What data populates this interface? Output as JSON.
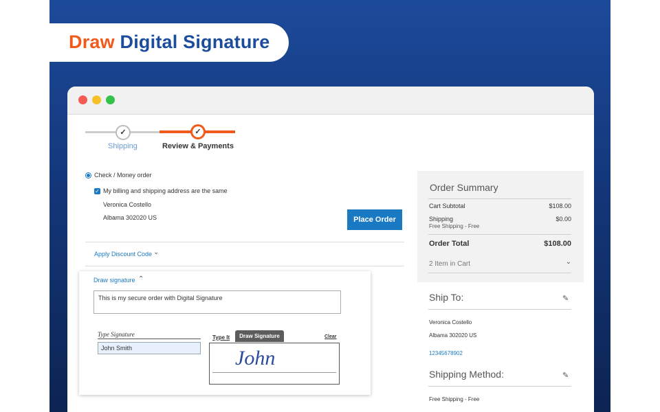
{
  "banner": {
    "title_accent": "Draw",
    "title_main": "Digital Signature"
  },
  "colors": {
    "accent_orange": "#f05a1a",
    "brand_blue": "#1979c3",
    "background_blue": "#1c4a9a"
  },
  "browser": {
    "window_controls": [
      "close",
      "minimize",
      "maximize"
    ]
  },
  "progress": {
    "steps": [
      {
        "label": "Shipping",
        "state": "complete"
      },
      {
        "label": "Review & Payments",
        "state": "active"
      }
    ]
  },
  "payment": {
    "method_label": "Check / Money order",
    "same_address_label": "My billing and shipping address are the same",
    "address_name": "Veronica Costello",
    "address_line": "Albama 302020  US",
    "place_order_label": "Place Order"
  },
  "discount": {
    "link_label": "Apply Discount Code"
  },
  "signature": {
    "section_label": "Draw signature",
    "comment_text": "This is my secure order with Digital Signature",
    "type_signature_label": "Type Signature",
    "typed_name": "John Smith",
    "tab_type": "Type It",
    "tab_draw": "Draw Signature",
    "clear_label": "Clear",
    "drawn_text": "John"
  },
  "summary": {
    "title": "Order Summary",
    "subtotal_label": "Cart Subtotal",
    "subtotal_value": "$108.00",
    "shipping_label": "Shipping",
    "shipping_sub": "Free Shipping - Free",
    "shipping_value": "$0.00",
    "total_label": "Order Total",
    "total_value": "$108.00",
    "items_in_cart": "2 Item in Cart"
  },
  "ship_to": {
    "title": "Ship To:",
    "name": "Veronica Costello",
    "address": "Albama 302020  US",
    "phone": "12345678902"
  },
  "shipping_method": {
    "title": "Shipping Method:",
    "value": "Free Shipping - Free"
  }
}
